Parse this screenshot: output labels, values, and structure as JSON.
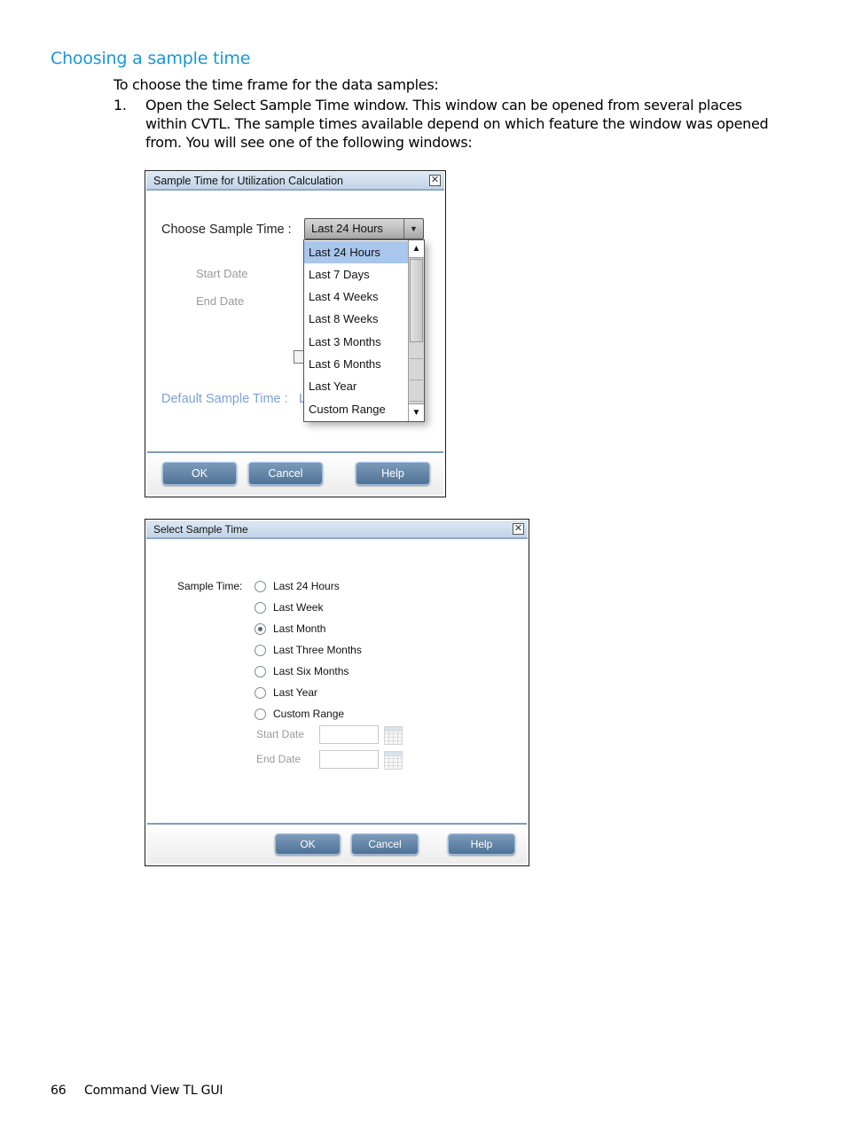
{
  "document": {
    "heading": "Choosing a sample time",
    "intro": "To choose the time frame for the data samples:",
    "steps": [
      {
        "number": "1.",
        "text": "Open the Select Sample Time window. This window can be opened from several places within CVTL. The sample times available depend on which feature the window was opened from. You will see one of the following windows:"
      }
    ],
    "footer": {
      "page_number": "66",
      "section": "Command View TL GUI"
    }
  },
  "dialog1": {
    "title": "Sample Time for Utilization Calculation",
    "close_icon": "close-icon",
    "choose_label": "Choose Sample Time :",
    "combo_value": "Last 24 Hours",
    "dropdown_options": [
      {
        "label": "Last 24 Hours",
        "selected": true
      },
      {
        "label": "Last 7 Days",
        "selected": false
      },
      {
        "label": "Last 4 Weeks",
        "selected": false
      },
      {
        "label": "Last 8 Weeks",
        "selected": false
      },
      {
        "label": "Last 3 Months",
        "selected": false
      },
      {
        "label": "Last 6 Months",
        "selected": false
      },
      {
        "label": "Last Year",
        "selected": false
      },
      {
        "label": "Custom Range",
        "selected": false
      }
    ],
    "start_date_label": "Start Date",
    "end_date_label": "End Date",
    "default_label": "Default Sample Time :",
    "default_value_partial": "L",
    "buttons": {
      "ok": "OK",
      "cancel": "Cancel",
      "help": "Help"
    }
  },
  "dialog2": {
    "title": "Select Sample Time",
    "close_icon": "close-icon",
    "sample_time_label": "Sample Time:",
    "options": [
      {
        "label": "Last 24 Hours",
        "checked": false
      },
      {
        "label": "Last Week",
        "checked": false
      },
      {
        "label": "Last Month",
        "checked": true
      },
      {
        "label": "Last Three Months",
        "checked": false
      },
      {
        "label": "Last Six Months",
        "checked": false
      },
      {
        "label": "Last Year",
        "checked": false
      },
      {
        "label": "Custom Range",
        "checked": false
      }
    ],
    "start_date_label": "Start Date",
    "start_date_value": "",
    "end_date_label": "End Date",
    "end_date_value": "",
    "buttons": {
      "ok": "OK",
      "cancel": "Cancel",
      "help": "Help"
    }
  }
}
